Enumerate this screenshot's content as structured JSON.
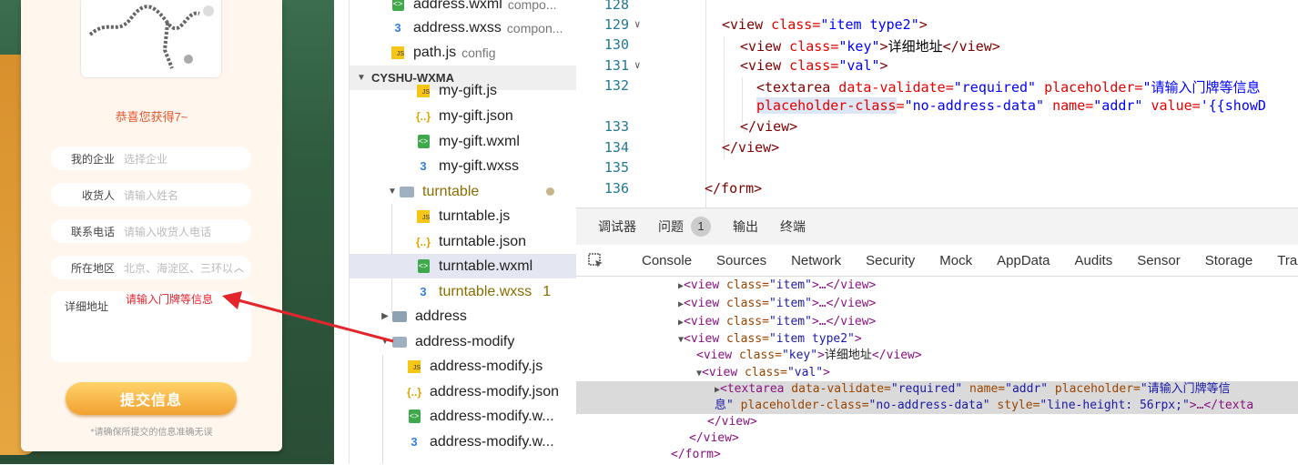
{
  "simulator": {
    "congrats": "恭喜您获得7~",
    "fields": [
      {
        "label": "我的企业",
        "placeholder": "选择企业"
      },
      {
        "label": "收货人",
        "placeholder": "请输入姓名"
      },
      {
        "label": "联系电话",
        "placeholder": "请输入收货人电话"
      },
      {
        "label": "所在地区",
        "placeholder": "北京、海淀区、三环以内"
      }
    ],
    "address_label": "详细地址",
    "address_placeholder": "请输入门牌等信息",
    "submit_label": "提交信息",
    "notice": "*请确保所提交的信息准确无误"
  },
  "file_tree": {
    "project": "CYSHU-WXMA",
    "items": [
      {
        "name": "address.wxml",
        "sub": "compo...",
        "type": "wxml"
      },
      {
        "name": "address.wxss",
        "sub": "compon...",
        "type": "wxss"
      },
      {
        "name": "path.js",
        "sub": "config",
        "type": "js"
      },
      {
        "name": "my-gift.js",
        "type": "js"
      },
      {
        "name": "my-gift.json",
        "type": "json"
      },
      {
        "name": "my-gift.wxml",
        "type": "wxml"
      },
      {
        "name": "my-gift.wxss",
        "type": "wxss"
      },
      {
        "name": "turntable",
        "type": "folder"
      },
      {
        "name": "turntable.js",
        "type": "js"
      },
      {
        "name": "turntable.json",
        "type": "json"
      },
      {
        "name": "turntable.wxml",
        "type": "wxml"
      },
      {
        "name": "turntable.wxss",
        "type": "wxss",
        "badge": "1"
      },
      {
        "name": "address",
        "type": "folder"
      },
      {
        "name": "address-modify",
        "type": "folder"
      },
      {
        "name": "address-modify.js",
        "type": "js"
      },
      {
        "name": "address-modify.json",
        "type": "json"
      },
      {
        "name": "address-modify.w...",
        "type": "wxml"
      },
      {
        "name": "address-modify.w...",
        "type": "wxss"
      }
    ]
  },
  "editor": {
    "line_numbers": [
      "128",
      "129",
      "130",
      "131",
      "132",
      "133",
      "134",
      "135",
      "136"
    ],
    "lines": {
      "l129": {
        "t1": "<view",
        "a1": " class=",
        "v1": "\"item type2\"",
        "t2": ">"
      },
      "l130": {
        "t1": "<view",
        "a1": " class=",
        "v1": "\"key\"",
        "t2": ">",
        "x": "详细地址",
        "t3": "</view>"
      },
      "l131": {
        "t1": "<view",
        "a1": " class=",
        "v1": "\"val\"",
        "t2": ">"
      },
      "l132": {
        "t1": "<textarea",
        "a1": " data-validate=",
        "v1": "\"required\"",
        "a2": " placeholder=",
        "v2": "\"请输入门牌等信息"
      },
      "l132b": {
        "a1": "placeholder-class",
        "a1b": "=",
        "v1": "\"no-address-data\"",
        "a2": " name=",
        "v2": "\"addr\"",
        "a3": " value=",
        "v3": "'{{showD"
      },
      "l133": {
        "t1": "</view>"
      },
      "l134": {
        "t1": "</view>"
      },
      "l136": {
        "t1": "</form>"
      }
    }
  },
  "devtools": {
    "top_tabs": [
      "调试器",
      "问题",
      "输出",
      "终端"
    ],
    "issues_count": "1",
    "panel_tabs": [
      "Console",
      "Sources",
      "Network",
      "Security",
      "Mock",
      "AppData",
      "Audits",
      "Sensor",
      "Storage",
      "Tra"
    ],
    "dom": {
      "item_tag": "<view",
      "item_attr": " class=",
      "item_val": "\"item\"",
      "item_rest": ">…</view>",
      "type2_val": "\"item type2\"",
      "close": ">",
      "key_val": "\"key\"",
      "key_text": "详细地址",
      "view_close": "</view>",
      "val_val": "\"val\"",
      "ta_tag": "<textarea",
      "ta_a1": " data-validate=",
      "ta_v1": "\"required\"",
      "ta_a2": " name=",
      "ta_v2": "\"addr\"",
      "ta_a3": " placeholder=",
      "ta_v3": "\"请输入门牌等信",
      "ta_cont": "息\"",
      "ta_a4": " placeholder-class=",
      "ta_v4": "\"no-address-data\"",
      "ta_a5": " style=",
      "ta_v5": "\"line-height: 56rpx;\"",
      "ta_rest": ">…</texta",
      "form_close": "</form>"
    }
  }
}
